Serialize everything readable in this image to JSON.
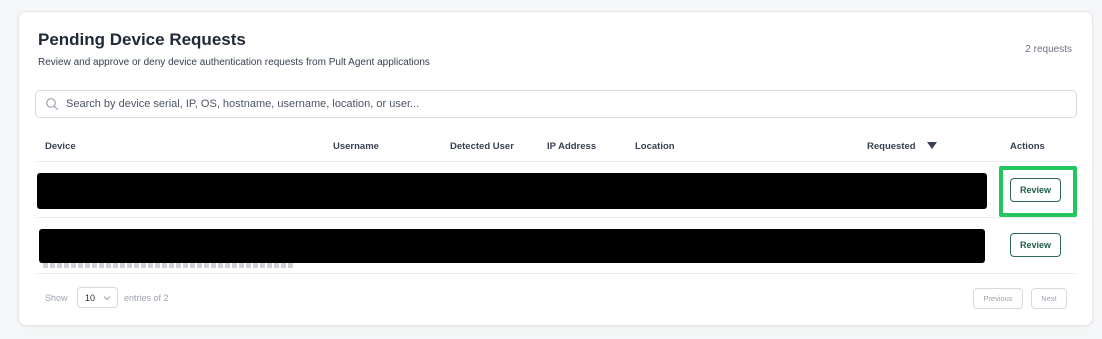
{
  "header": {
    "title": "Pending Device Requests",
    "subtitle": "Review and approve or deny device authentication requests from Pult Agent applications",
    "count": "2 requests"
  },
  "search": {
    "placeholder": "Search by device serial, IP, OS, hostname, username, location, or user...",
    "value": ""
  },
  "table": {
    "columns": [
      "Device",
      "Username",
      "Detected User",
      "IP Address",
      "Location",
      "Requested",
      "Actions"
    ],
    "sort_column": "Requested",
    "sort_direction": "descending",
    "rows": [
      {
        "content_redacted": true,
        "action_label": "Review",
        "highlighted": true
      },
      {
        "content_redacted": true,
        "action_label": "Review",
        "highlighted": false
      }
    ]
  },
  "footer": {
    "show_label": "Show",
    "page_size": "10",
    "entries_label": "entries of 2",
    "prev_label": "Previous",
    "next_label": "Next"
  },
  "colors": {
    "accent": "#1e5e44",
    "highlight": "#22c55e",
    "redaction": "#000000"
  },
  "icons": {
    "search": "search-icon",
    "sort": "caret-down-icon",
    "page_size_toggle": "chevron-down-icon"
  }
}
